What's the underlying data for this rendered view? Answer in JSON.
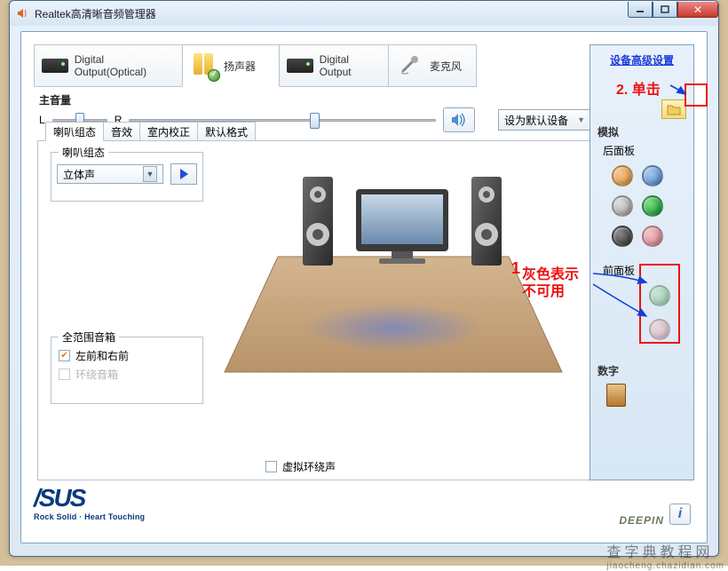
{
  "window": {
    "title": "Realtek高清晰音频管理器"
  },
  "win_buttons": {
    "close": "✕"
  },
  "top_tabs": [
    {
      "label": "Digital Output(Optical)",
      "active": false
    },
    {
      "label": "扬声器",
      "active": true
    },
    {
      "label": "Digital Output",
      "active": false
    },
    {
      "label": "麦克风",
      "active": false
    }
  ],
  "master_volume": {
    "label": "主音量",
    "left": "L",
    "right": "R",
    "balance_pos_pct": 50,
    "level_pos_pct": 59
  },
  "default_device": {
    "label": "设为默认设备"
  },
  "sub_tabs": [
    {
      "label": "喇叭组态",
      "active": true
    },
    {
      "label": "音效",
      "active": false
    },
    {
      "label": "室内校正",
      "active": false
    },
    {
      "label": "默认格式",
      "active": false
    }
  ],
  "speaker_config": {
    "group_label": "喇叭组态",
    "selected": "立体声"
  },
  "full_range": {
    "group_label": "全范围音箱",
    "front": {
      "label": "左前和右前",
      "checked": true,
      "enabled": true
    },
    "surround": {
      "label": "环绕音箱",
      "checked": false,
      "enabled": false
    }
  },
  "virtual_surround": {
    "label": "虚拟环绕声",
    "checked": false
  },
  "right_panel": {
    "adv_link": "设备高级设置",
    "analog_label": "模拟",
    "rear_label": "后面板",
    "rear_jacks": [
      {
        "name": "jack-orange",
        "bg": "radial-gradient(circle at 35% 35%, #f6c790, #d88a3a)"
      },
      {
        "name": "jack-blue",
        "bg": "radial-gradient(circle at 35% 35%, #a7c9f0, #4a7fc0)"
      },
      {
        "name": "jack-gray",
        "bg": "radial-gradient(circle at 35% 35%, #ddd, #9a9a9a)"
      },
      {
        "name": "jack-green",
        "bg": "radial-gradient(circle at 35% 35%, #76e083, #118a2a)"
      },
      {
        "name": "jack-black",
        "bg": "radial-gradient(circle at 35% 35%, #888, #2a2a2a)"
      },
      {
        "name": "jack-pink",
        "bg": "radial-gradient(circle at 35% 35%, #f3c2c6, #d27a84)"
      }
    ],
    "front_label": "前面板",
    "front_jacks": [
      {
        "name": "jack-front-green",
        "bg": "radial-gradient(circle at 35% 35%, #bfe3c4, #7fb892)"
      },
      {
        "name": "jack-front-pink",
        "bg": "radial-gradient(circle at 35% 35%, #ecd0d3, #d0a6ac)"
      }
    ],
    "digital_label": "数字"
  },
  "brand": {
    "name": "/SUS",
    "tag": "Rock Solid · Heart Touching"
  },
  "partner": "DEEPIN",
  "annotations": {
    "step1_num": "1",
    "step1a": "灰色表示",
    "step1b": "不可用",
    "step2": "2. 单击"
  },
  "watermark": {
    "main": "查字典教程网",
    "sub": "jiaocheng.chazidian.com"
  }
}
